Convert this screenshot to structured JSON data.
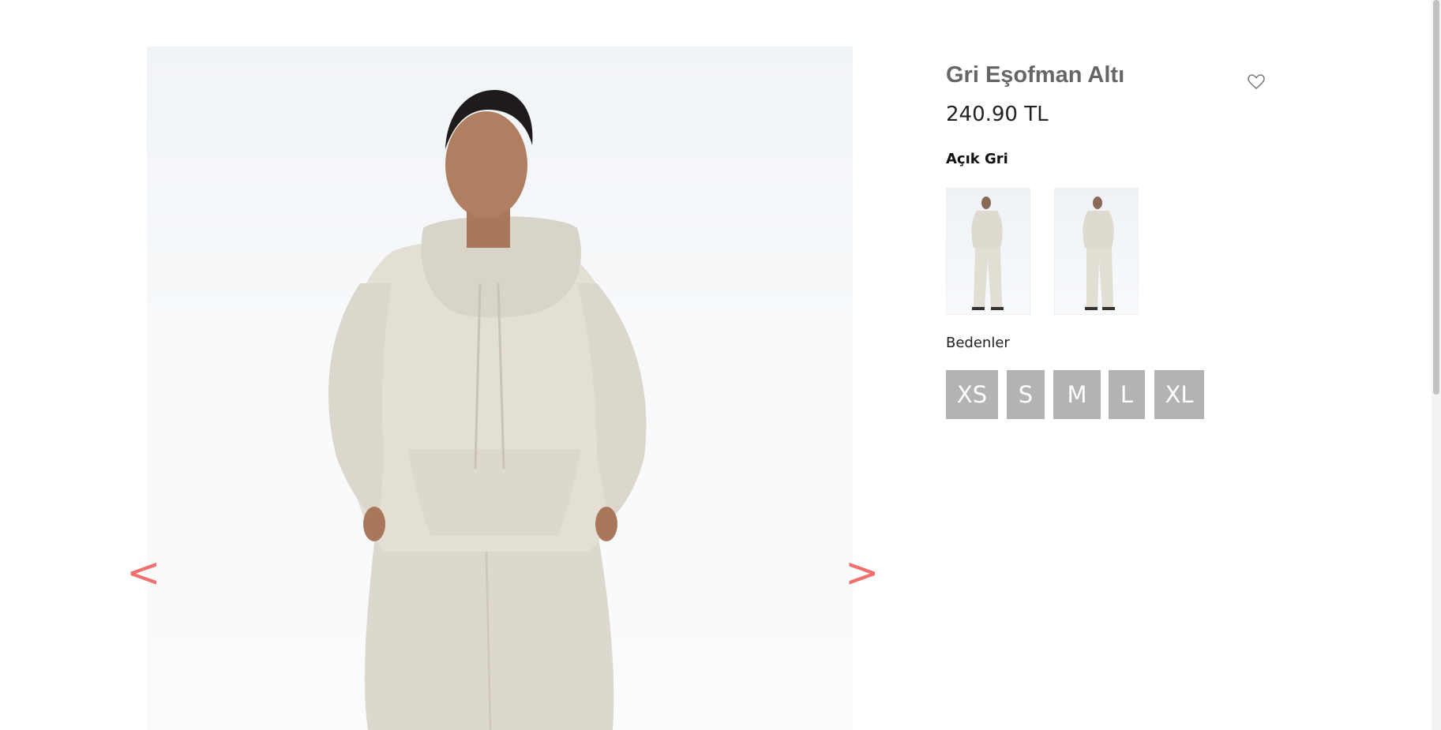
{
  "product": {
    "title": "Gri Eşofman Altı",
    "price": "240.90 TL",
    "color_label": "Açık Gri",
    "sizes_label": "Bedenler",
    "sizes": [
      "XS",
      "S",
      "M",
      "L",
      "XL"
    ]
  },
  "gallery": {
    "prev_label": "<",
    "next_label": ">"
  },
  "colors": {
    "arrow": "#f07070",
    "size_button_bg": "#b3b3b3",
    "title": "#666666"
  },
  "icons": {
    "favorite": "heart-outline-icon"
  }
}
